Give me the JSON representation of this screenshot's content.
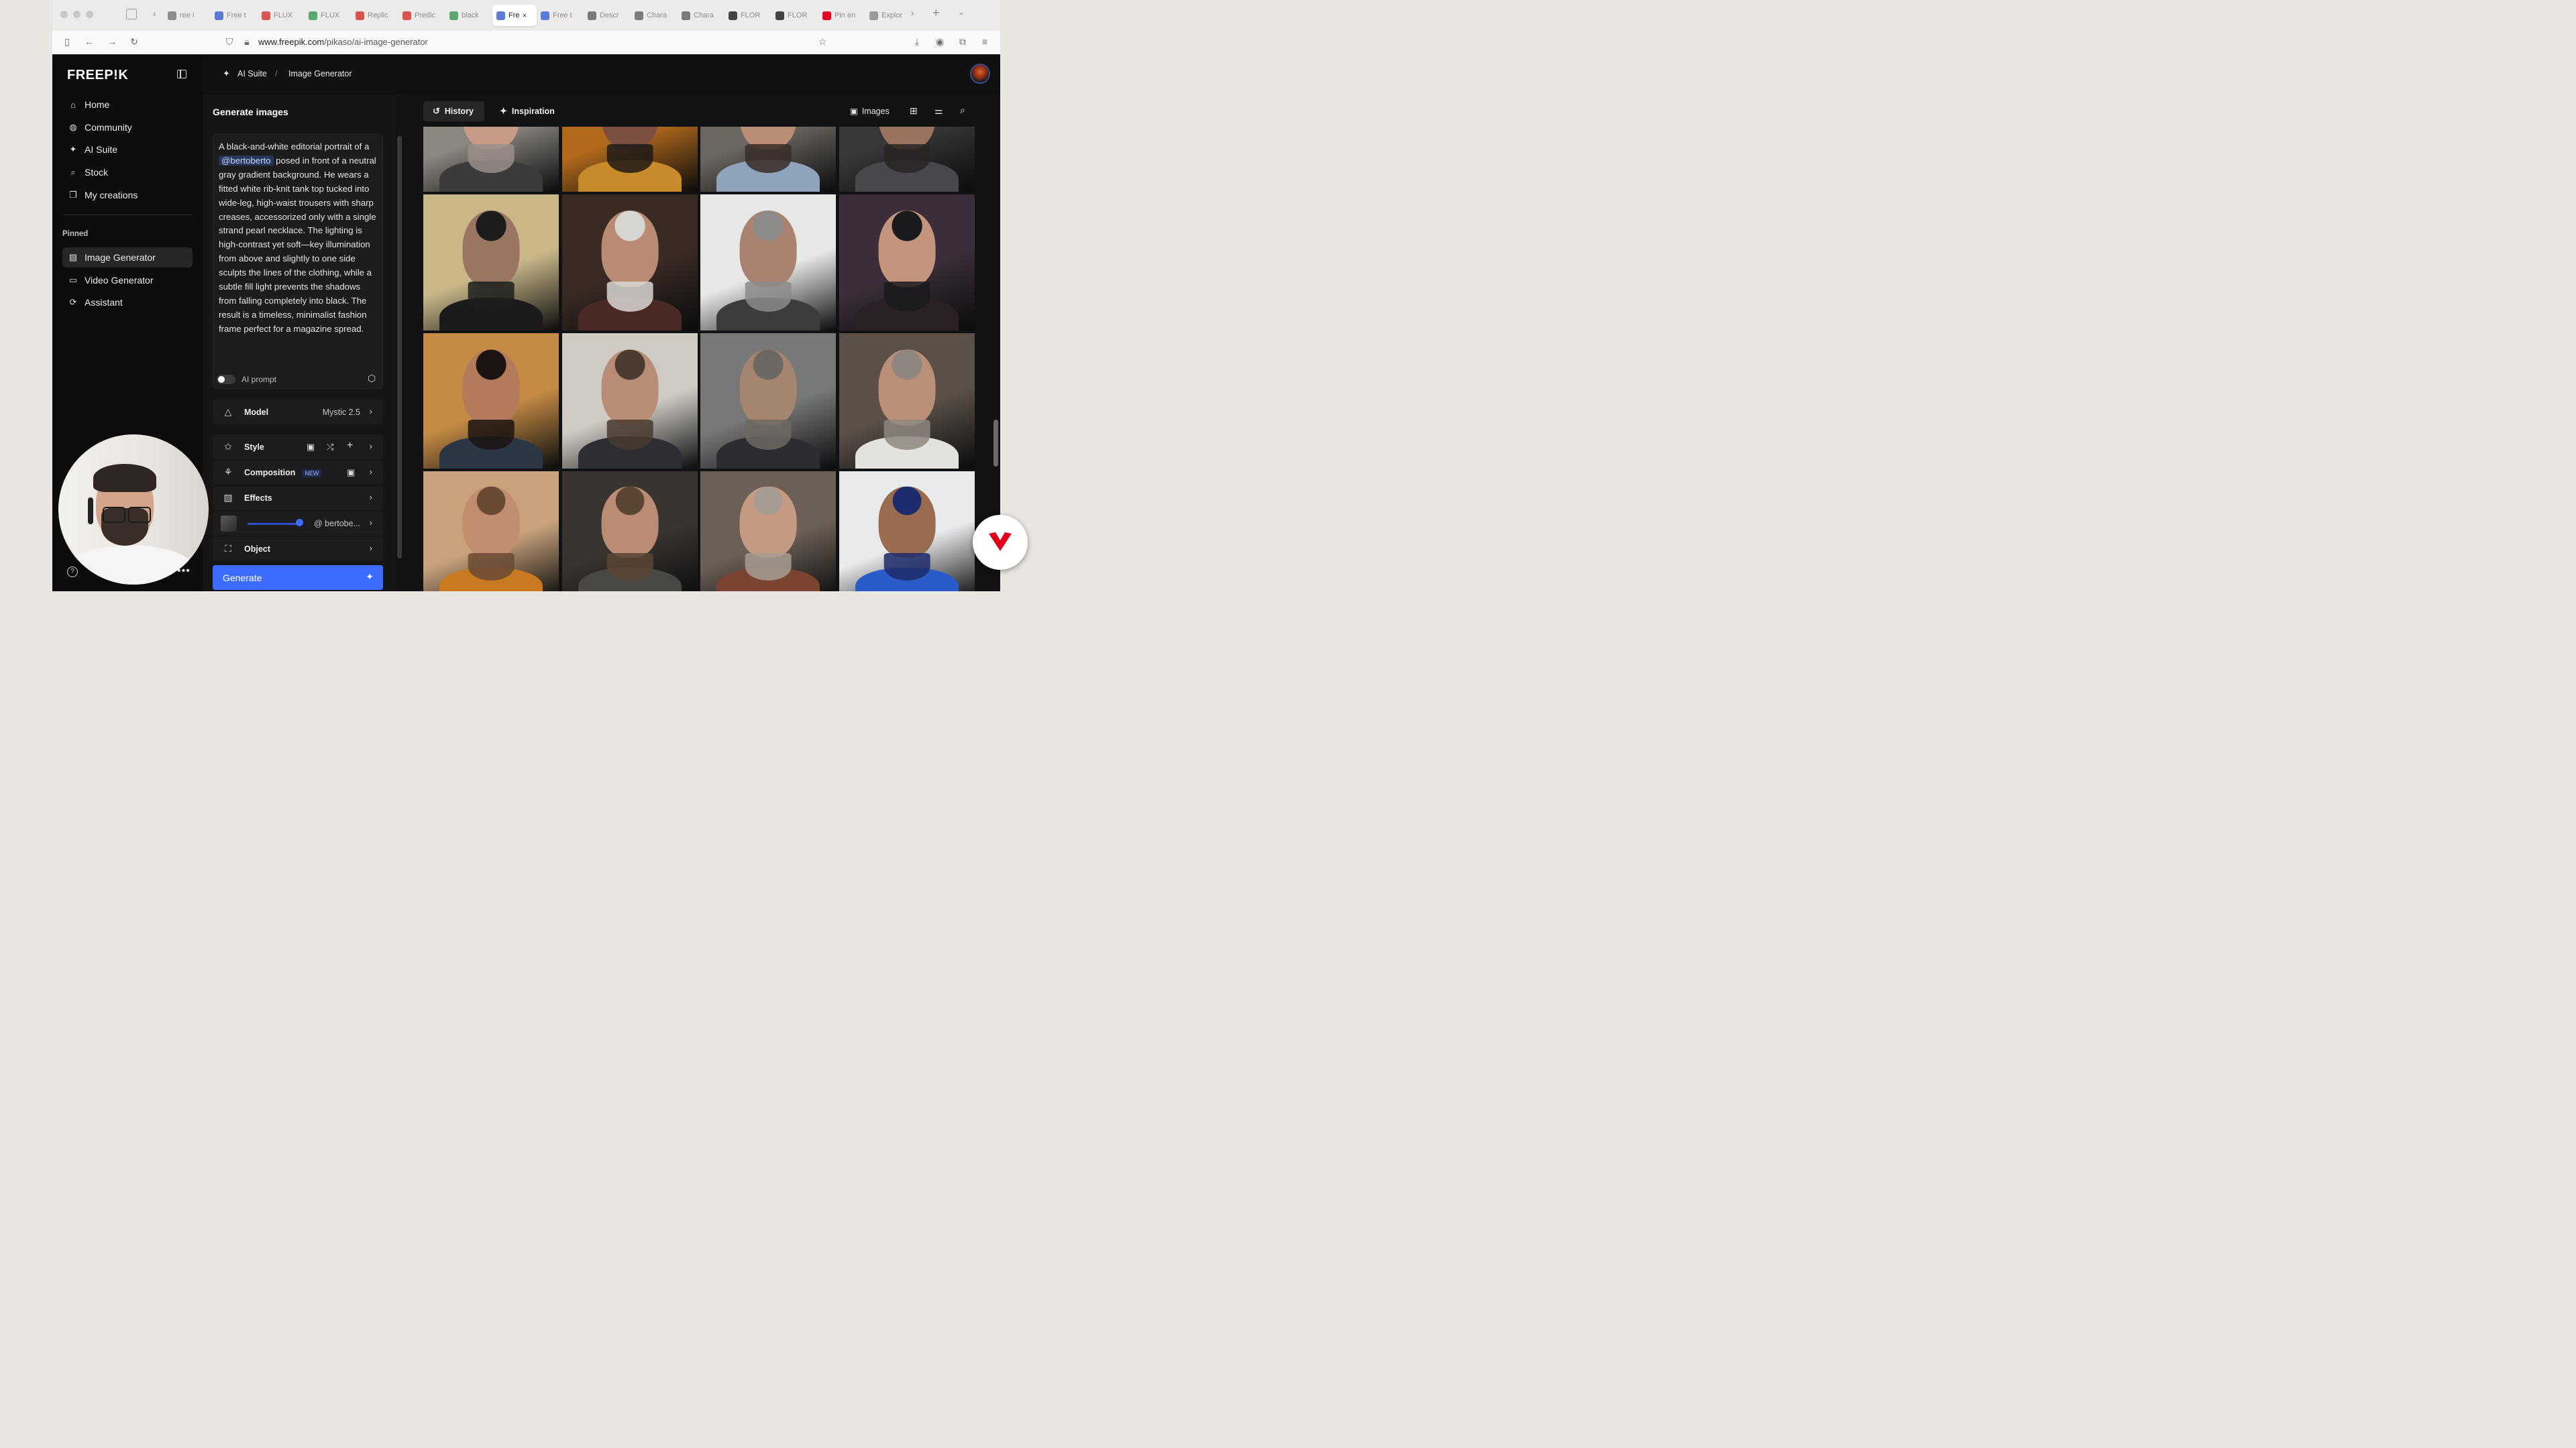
{
  "browser": {
    "tabs": [
      {
        "label": "ree i",
        "color": "#8d8c8a",
        "icon": "doc-icon"
      },
      {
        "label": "Free t",
        "color": "#5b7bd5",
        "icon": "freepik-icon"
      },
      {
        "label": "FLUX",
        "color": "#d9534f",
        "icon": "reddit-like-icon"
      },
      {
        "label": "FLUX",
        "color": "#5aa86a",
        "icon": "hf-icon"
      },
      {
        "label": "Replic",
        "color": "#d9534f",
        "icon": "replicate-icon"
      },
      {
        "label": "Predic",
        "color": "#d9534f",
        "icon": "replicate-icon"
      },
      {
        "label": "black",
        "color": "#5aa86a",
        "icon": "hf-icon"
      },
      {
        "label": "Fre",
        "color": "#5b7bd5",
        "icon": "freepik-icon",
        "active": true
      },
      {
        "label": "Free t",
        "color": "#5b7bd5",
        "icon": "freepik-icon"
      },
      {
        "label": "Descr",
        "color": "#7a7a7a",
        "icon": "openai-icon"
      },
      {
        "label": "Chara",
        "color": "#7a7a7a",
        "icon": "openai-icon"
      },
      {
        "label": "Chara",
        "color": "#7a7a7a",
        "icon": "openai-icon"
      },
      {
        "label": "FLOR",
        "color": "#444",
        "icon": "flora-icon"
      },
      {
        "label": "FLOR",
        "color": "#444",
        "icon": "flora-icon"
      },
      {
        "label": "Pin en",
        "color": "#e60023",
        "icon": "pinterest-icon"
      },
      {
        "label": "Explor",
        "color": "#9a9a9a",
        "icon": "explore-icon"
      }
    ],
    "url_domain": "www.freepik.com",
    "url_path": "/pikaso/ai-image-generator"
  },
  "sidebar": {
    "logo": "FREEP!K",
    "items": [
      {
        "label": "Home",
        "icon": "home-icon",
        "glyph": "⌂"
      },
      {
        "label": "Community",
        "icon": "globe-icon",
        "glyph": "◍"
      },
      {
        "label": "AI Suite",
        "icon": "sparkles-icon",
        "glyph": "✦"
      },
      {
        "label": "Stock",
        "icon": "search-icon",
        "glyph": "⌕"
      },
      {
        "label": "My creations",
        "icon": "creations-icon",
        "glyph": "❐"
      }
    ],
    "pinned_label": "Pinned",
    "pinned": [
      {
        "label": "Image Generator",
        "icon": "image-icon",
        "glyph": "▨",
        "active": true
      },
      {
        "label": "Video Generator",
        "icon": "video-icon",
        "glyph": "▭"
      },
      {
        "label": "Assistant",
        "icon": "assistant-icon",
        "glyph": "⟳"
      }
    ]
  },
  "topbar": {
    "crumb_1": "AI Suite",
    "crumb_sep": "/",
    "crumb_2": "Image Generator"
  },
  "panel": {
    "title": "Generate images",
    "prompt_before": "A black-and-white editorial portrait of a ",
    "prompt_mention": "@bertoberto",
    "prompt_after": " posed in front of a neutral gray gradient background. He wears a fitted white rib-knit tank top tucked into wide-leg, high-waist trousers with sharp creases, accessorized only with a single strand pearl necklace. The lighting is high-contrast yet soft—key illumination from above and slightly to one side sculpts the lines of the clothing, while a subtle fill light prevents the shadows from falling completely into black. The result is a timeless, minimalist fashion frame perfect for a magazine spread.",
    "ai_prompt_label": "AI prompt",
    "model_label": "Model",
    "model_value": "Mystic 2.5",
    "style_label": "Style",
    "composition_label": "Composition",
    "composition_badge": "NEW",
    "effects_label": "Effects",
    "character_value": "@ bertobe...",
    "character_strength": 0.92,
    "object_label": "Object",
    "generate_label": "Generate"
  },
  "gallery": {
    "tab_history": "History",
    "tab_inspiration": "Inspiration",
    "images_label": "Images",
    "tiles": [
      {
        "bg": "#8a8680",
        "skin": "#c79a86",
        "hair": "#9b8f88",
        "cloth": "#3b3b3d"
      },
      {
        "bg": "#b36a1d",
        "skin": "#7b5040",
        "hair": "#1f1a17",
        "cloth": "#c98a2a"
      },
      {
        "bg": "#6d6761",
        "skin": "#b98d76",
        "hair": "#3a2d27",
        "cloth": "#8fa3bb"
      },
      {
        "bg": "#38383a",
        "skin": "#9b7460",
        "hair": "#2a2523",
        "cloth": "#46484b"
      },
      {
        "bg": "#c9b788",
        "skin": "#9a7662",
        "hair": "#1d1d1d",
        "cloth": "#1b1b1c"
      },
      {
        "bg": "#3a2a24",
        "skin": "#b88b72",
        "hair": "#d8d6d2",
        "cloth": "#4a2a24"
      },
      {
        "bg": "#e8e8e6",
        "skin": "#a98270",
        "hair": "#8d8b89",
        "cloth": "#3a3d3a"
      },
      {
        "bg": "#3b2e3a",
        "skin": "#c2957c",
        "hair": "#1a1a1c",
        "cloth": "#2b2125"
      },
      {
        "bg": "#c58b45",
        "skin": "#b37a5c",
        "hair": "#1c1410",
        "cloth": "#2c3645"
      },
      {
        "bg": "#cfcac3",
        "skin": "#b98c75",
        "hair": "#4a3a30",
        "cloth": "#2d2e33"
      },
      {
        "bg": "#777878",
        "skin": "#a58470",
        "hair": "#6d6863",
        "cloth": "#2b2d30"
      },
      {
        "bg": "#5a5048",
        "skin": "#ba8e77",
        "hair": "#8f877f",
        "cloth": "#e4e2de"
      },
      {
        "bg": "#c9a27c",
        "skin": "#c08d6e",
        "hair": "#6b4a34",
        "cloth": "#c97a1f"
      },
      {
        "bg": "#3a3430",
        "skin": "#b98c73",
        "hair": "#5a4535",
        "cloth": "#4a4845"
      },
      {
        "bg": "#6b5f56",
        "skin": "#c49a83",
        "hair": "#a79c92",
        "cloth": "#7a4430"
      },
      {
        "bg": "#e9eaec",
        "skin": "#9a6c4f",
        "hair": "#1d2a6b",
        "cloth": "#2a5bc9"
      }
    ]
  }
}
